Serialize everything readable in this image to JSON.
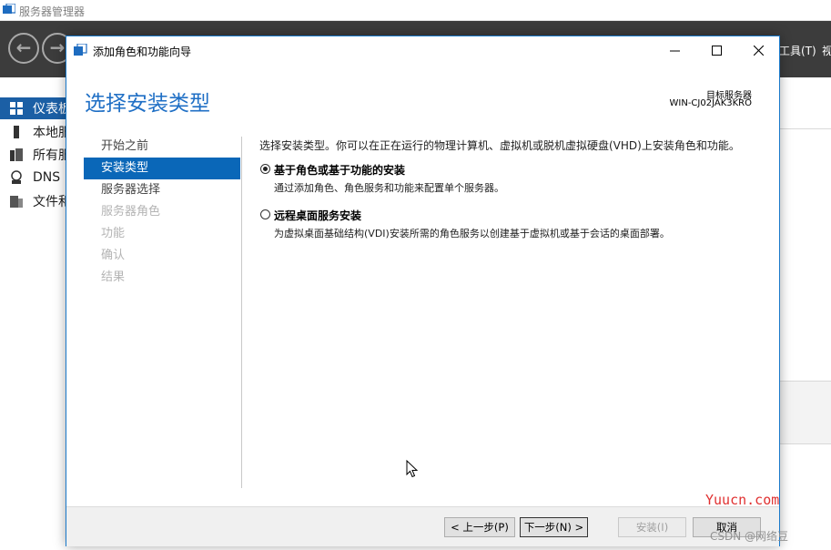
{
  "background_app": {
    "title": "服务器管理器",
    "menu_tools": "工具(T)",
    "menu_view": "视",
    "sidebar": [
      {
        "label": "仪表板",
        "icon": "dashboard-icon",
        "active": true
      },
      {
        "label": "本地服务器",
        "icon": "server-icon",
        "active": false
      },
      {
        "label": "所有服务器",
        "icon": "servers-icon",
        "active": false
      },
      {
        "label": "DNS",
        "icon": "dns-icon",
        "active": false
      },
      {
        "label": "文件和存储服务",
        "icon": "file-storage-icon",
        "active": false
      }
    ]
  },
  "wizard": {
    "title": "添加角色和功能向导",
    "heading": "选择安装类型",
    "destination_label": "目标服务器",
    "destination_value": "WIN-CJ02JAK3KRO",
    "steps": [
      {
        "label": "开始之前",
        "state": "normal"
      },
      {
        "label": "安装类型",
        "state": "active"
      },
      {
        "label": "服务器选择",
        "state": "normal"
      },
      {
        "label": "服务器角色",
        "state": "disabled"
      },
      {
        "label": "功能",
        "state": "disabled"
      },
      {
        "label": "确认",
        "state": "disabled"
      },
      {
        "label": "结果",
        "state": "disabled"
      }
    ],
    "intro": "选择安装类型。你可以在正在运行的物理计算机、虚拟机或脱机虚拟硬盘(VHD)上安装角色和功能。",
    "options": [
      {
        "title": "基于角色或基于功能的安装",
        "description": "通过添加角色、角色服务和功能来配置单个服务器。",
        "selected": true
      },
      {
        "title": "远程桌面服务安装",
        "description": "为虚拟桌面基础结构(VDI)安装所需的角色服务以创建基于虚拟机或基于会话的桌面部署。",
        "selected": false
      }
    ],
    "buttons": {
      "previous": "< 上一步(P)",
      "next": "下一步(N) >",
      "install": "安装(I)",
      "cancel": "取消"
    }
  },
  "watermark": {
    "site": "Yuucn.com",
    "credit": "CSDN @网络豆"
  },
  "colors": {
    "accent": "#1f6fc5",
    "active_step": "#0a67b8",
    "toolbar": "#3c3c3c",
    "watermark_red": "#e03030"
  }
}
